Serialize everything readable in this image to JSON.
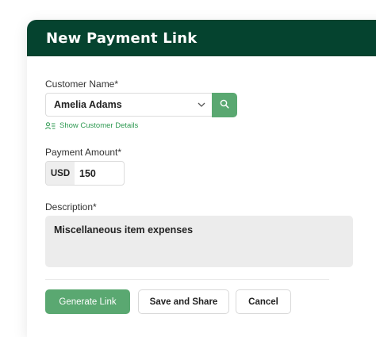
{
  "header": {
    "title": "New Payment Link"
  },
  "customer": {
    "label": "Customer Name*",
    "value": "Amelia Adams",
    "details_link": "Show Customer Details"
  },
  "payment": {
    "label": "Payment Amount*",
    "currency": "USD",
    "amount": "150"
  },
  "description": {
    "label": "Description*",
    "value": "Miscellaneous item expenses"
  },
  "actions": {
    "generate_label": "Generate Link",
    "save_share_label": "Save and Share",
    "cancel_label": "Cancel"
  },
  "icons": {
    "search": "search-icon",
    "dropdown": "chevron-down-icon",
    "customer_details": "user-list-icon"
  },
  "colors": {
    "header_bg": "#05432f",
    "accent_green": "#5aa871",
    "link_green": "#2f9a52"
  }
}
